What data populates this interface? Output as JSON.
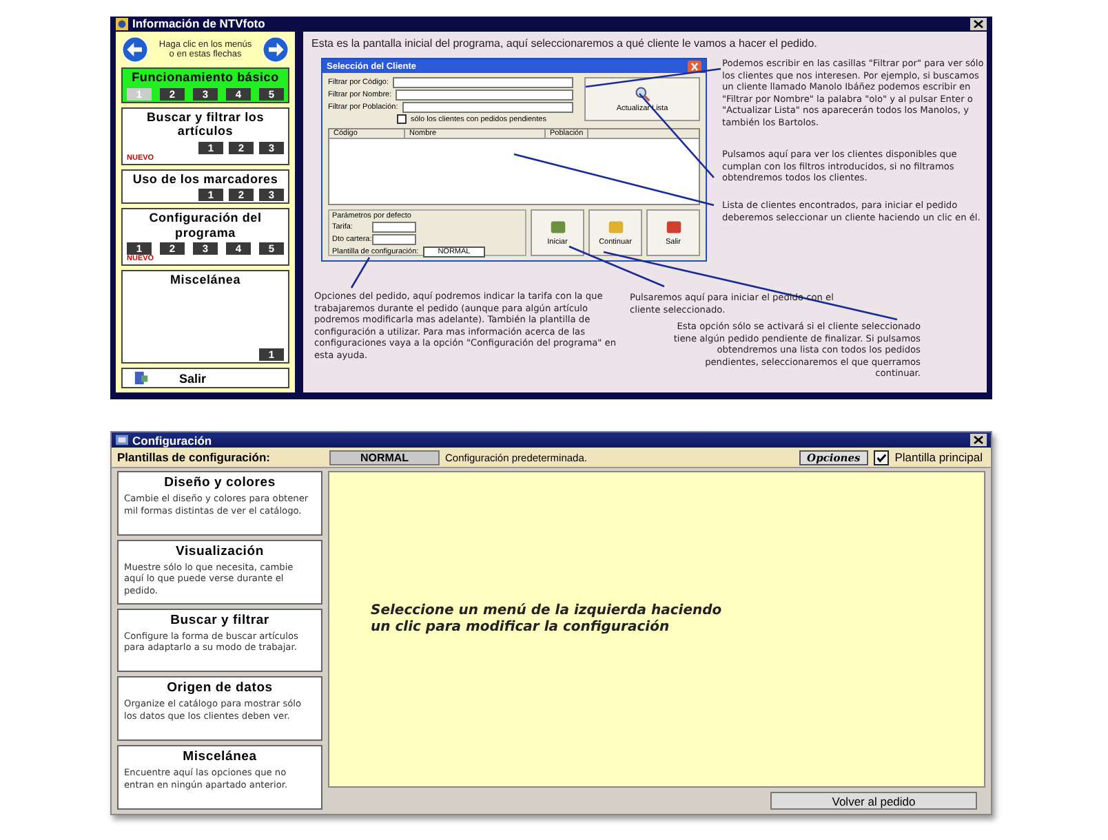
{
  "help_window": {
    "title": "Información de NTVfoto",
    "nav_hint": "Haga clic en los menús o en estas flechas",
    "sections": [
      {
        "title": "Funcionamiento básico",
        "selected": true,
        "pages": [
          {
            "label": "1",
            "selected": true
          },
          {
            "label": "2",
            "selected": false
          },
          {
            "label": "3",
            "selected": false
          },
          {
            "label": "4",
            "selected": false
          },
          {
            "label": "5",
            "selected": false
          }
        ]
      },
      {
        "title": "Buscar y filtrar los artículos",
        "selected": false,
        "badge": "NUEVO",
        "pages": [
          {
            "label": "1",
            "selected": false
          },
          {
            "label": "2",
            "selected": false
          },
          {
            "label": "3",
            "selected": false
          }
        ]
      },
      {
        "title": "Uso de los marcadores",
        "selected": false,
        "pages": [
          {
            "label": "1",
            "selected": false
          },
          {
            "label": "2",
            "selected": false
          },
          {
            "label": "3",
            "selected": false
          }
        ]
      },
      {
        "title": "Configuración del programa",
        "selected": false,
        "badge": "NUEVO",
        "pages": [
          {
            "label": "1",
            "selected": false
          },
          {
            "label": "2",
            "selected": false
          },
          {
            "label": "3",
            "selected": false
          },
          {
            "label": "4",
            "selected": false
          },
          {
            "label": "5",
            "selected": false
          }
        ]
      },
      {
        "title": "Miscelánea",
        "selected": false,
        "pages": [
          {
            "label": "1",
            "selected": false
          }
        ]
      }
    ],
    "exit_label": "Salir",
    "intro": "Esta es la pantalla inicial del programa, aquí seleccionaremos a qué cliente le vamos a hacer el pedido.",
    "dialog": {
      "title": "Selección del Cliente",
      "filters": [
        "Filtrar por Código:",
        "Filtrar por Nombre:",
        "Filtrar por Población:"
      ],
      "pending_only": {
        "label": "sólo los clientes con pedidos pendientes",
        "checked": false
      },
      "refresh_button": "Actualizar Lista",
      "columns": [
        "Código",
        "Nombre",
        "Población"
      ],
      "defaults_title": "Parámetros por defecto",
      "fields": [
        "Tarifa:",
        "Dto cartera:"
      ],
      "template_label": "Plantilla de configuración:",
      "template_value": "NORMAL",
      "buttons": [
        "Iniciar",
        "Continuar",
        "Salir"
      ]
    },
    "annotations": [
      "Podemos escribir en las casillas \"Filtrar por\" para ver sólo los clientes que nos interesen. Por ejemplo, si buscamos un cliente llamado Manolo Ibáñez podemos escribir en \"Filtrar por Nombre\" la palabra \"olo\" y al pulsar Enter o \"Actualizar Lista\" nos aparecerán todos los Manolos, y también los Bartolos.",
      "Pulsamos aquí para ver los clientes disponibles que cumplan con los filtros introducidos, si no filtramos obtendremos todos los clientes.",
      "Lista de clientes encontrados, para iniciar el pedido deberemos seleccionar un cliente haciendo un clic en él.",
      "Opciones del pedido, aquí podremos indicar la tarifa con la que trabajaremos durante el pedido (aunque para algún artículo podremos modificarla mas adelante). También la plantilla de configuración a utilizar. Para mas información acerca de las configuraciones vaya a la opción \"Configuración del programa\" en esta ayuda.",
      "Pulsaremos aquí para iniciar el pedido con el cliente seleccionado.",
      "Esta opción sólo se activará si el cliente seleccionado tiene algún pedido pendiente de finalizar. Si pulsamos obtendremos una lista con todos los pedidos pendientes, seleccionaremos el que querramos continuar."
    ]
  },
  "config_window": {
    "title": "Configuración",
    "templates_label": "Plantillas de configuración:",
    "template": "NORMAL",
    "template_description": "Configuración predeterminada.",
    "options_button": "Opciones",
    "main_template": {
      "label": "Plantilla principal",
      "checked": true
    },
    "menu": [
      {
        "title": "Diseño y colores",
        "description": "Cambie el diseño y colores para obtener mil formas distintas de ver el catálogo."
      },
      {
        "title": "Visualización",
        "description": "Muestre sólo lo que necesita, cambie aquí lo que puede verse durante el pedido."
      },
      {
        "title": "Buscar y filtrar",
        "description": "Configure la forma de buscar artículos para adaptarlo a su modo de trabajar."
      },
      {
        "title": "Origen de datos",
        "description": "Organize el catálogo para mostrar sólo los datos que los clientes deben ver."
      },
      {
        "title": "Miscelánea",
        "description": "Encuentre aquí las opciones que no entran en ningún apartado anterior."
      }
    ],
    "prompt": "Seleccione un menú de la izquierda haciendo un clic para modificar la configuración",
    "back_button": "Volver al pedido"
  }
}
